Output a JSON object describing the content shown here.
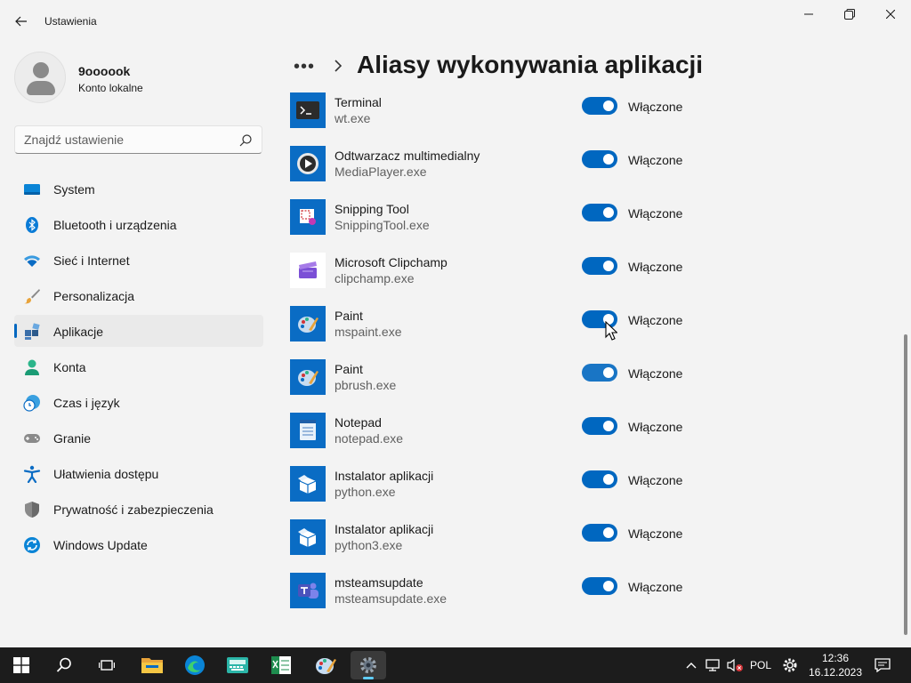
{
  "window": {
    "title": "Ustawienia",
    "back_label": "Wstecz"
  },
  "profile": {
    "name": "9oooook",
    "account_type": "Konto lokalne"
  },
  "search": {
    "placeholder": "Znajdź ustawienie"
  },
  "sidebar": {
    "items": [
      {
        "label": "System",
        "icon": "system-icon",
        "active": false
      },
      {
        "label": "Bluetooth i urządzenia",
        "icon": "bluetooth-icon",
        "active": false
      },
      {
        "label": "Sieć i Internet",
        "icon": "wifi-icon",
        "active": false
      },
      {
        "label": "Personalizacja",
        "icon": "brush-icon",
        "active": false
      },
      {
        "label": "Aplikacje",
        "icon": "apps-icon",
        "active": true
      },
      {
        "label": "Konta",
        "icon": "account-icon",
        "active": false
      },
      {
        "label": "Czas i język",
        "icon": "time-language-icon",
        "active": false
      },
      {
        "label": "Granie",
        "icon": "gamepad-icon",
        "active": false
      },
      {
        "label": "Ułatwienia dostępu",
        "icon": "accessibility-icon",
        "active": false
      },
      {
        "label": "Prywatność i zabezpieczenia",
        "icon": "shield-icon",
        "active": false
      },
      {
        "label": "Windows Update",
        "icon": "windows-update-icon",
        "active": false
      }
    ]
  },
  "header": {
    "breadcrumb_more": "•••",
    "title": "Aliasy wykonywania aplikacji"
  },
  "aliases": [
    {
      "name": "Terminal",
      "exe": "wt.exe",
      "state": "Włączone",
      "on": true,
      "icon": "terminal-icon"
    },
    {
      "name": "Odtwarzacz multimedialny",
      "exe": "MediaPlayer.exe",
      "state": "Włączone",
      "on": true,
      "icon": "media-player-icon"
    },
    {
      "name": "Snipping Tool",
      "exe": "SnippingTool.exe",
      "state": "Włączone",
      "on": true,
      "icon": "snipping-tool-icon"
    },
    {
      "name": "Microsoft Clipchamp",
      "exe": "clipchamp.exe",
      "state": "Włączone",
      "on": true,
      "icon": "clipchamp-icon"
    },
    {
      "name": "Paint",
      "exe": "mspaint.exe",
      "state": "Włączone",
      "on": true,
      "icon": "paint-icon"
    },
    {
      "name": "Paint",
      "exe": "pbrush.exe",
      "state": "Włączone",
      "on": true,
      "icon": "paint-icon"
    },
    {
      "name": "Notepad",
      "exe": "notepad.exe",
      "state": "Włączone",
      "on": true,
      "icon": "notepad-icon"
    },
    {
      "name": "Instalator aplikacji",
      "exe": "python.exe",
      "state": "Włączone",
      "on": true,
      "icon": "app-installer-icon"
    },
    {
      "name": "Instalator aplikacji",
      "exe": "python3.exe",
      "state": "Włączone",
      "on": true,
      "icon": "app-installer-icon"
    },
    {
      "name": "msteamsupdate",
      "exe": "msteamsupdate.exe",
      "state": "Włączone",
      "on": true,
      "icon": "teams-icon"
    }
  ],
  "taskbar": {
    "apps": [
      "start-icon",
      "search-icon",
      "task-view-icon",
      "file-explorer-icon",
      "edge-icon",
      "keyboard-app-icon",
      "spreadsheet-icon",
      "paint-icon",
      "settings-icon"
    ],
    "language": "POL",
    "time": "12:36",
    "date": "16.12.2023"
  },
  "colors": {
    "accent": "#0067c0",
    "background": "#f3f3f3",
    "taskbar": "#1c1c1c"
  }
}
